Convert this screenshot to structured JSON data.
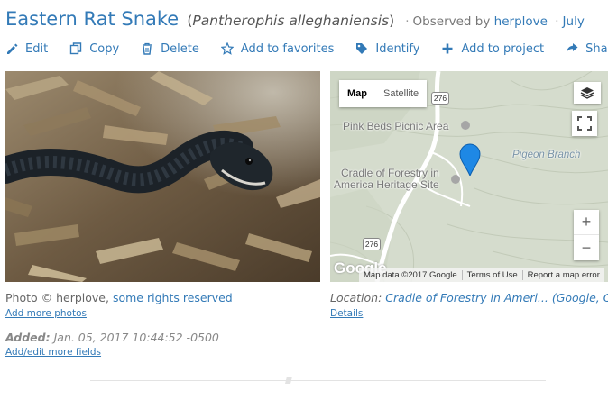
{
  "header": {
    "common_name": "Eastern Rat Snake",
    "scientific_name": "Pantherophis alleghaniensis",
    "observed_by_label": "Observed by",
    "observer": "herplove",
    "date": "July"
  },
  "actions": [
    {
      "label": "Edit",
      "icon": "pencil-icon"
    },
    {
      "label": "Copy",
      "icon": "copy-icon"
    },
    {
      "label": "Delete",
      "icon": "trash-icon"
    },
    {
      "label": "Add to favorites",
      "icon": "star-icon"
    },
    {
      "label": "Identify",
      "icon": "tag-icon"
    },
    {
      "label": "Add to project",
      "icon": "plus-icon"
    },
    {
      "label": "Share",
      "icon": "share-icon"
    }
  ],
  "map": {
    "type_map": "Map",
    "type_satellite": "Satellite",
    "zoom_in": "+",
    "zoom_out": "−",
    "labels": {
      "picnic": "Pink Beds Picnic Area",
      "cradle_line1": "Cradle of Forestry in",
      "cradle_line2": "America Heritage Site",
      "branch": "Pigeon Branch"
    },
    "route_top": "276",
    "route_bottom": "276",
    "logo": "Google",
    "footer": {
      "data": "Map data ©2017 Google",
      "terms": "Terms of Use",
      "report": "Report a map error"
    }
  },
  "photo": {
    "credit_prefix": "Photo © herplove,",
    "credit_link": "some rights reserved",
    "add_more": "Add more photos"
  },
  "location": {
    "label": "Location:",
    "value": "Cradle of Forestry in Ameri...",
    "sources": "(Google, OSM)",
    "details": "Details"
  },
  "added": {
    "label": "Added:",
    "value": "Jan. 05, 2017 10:44:52 -0500",
    "edit_fields": "Add/edit more fields"
  },
  "colors": {
    "link": "#337ab7",
    "pin": "#1e88e5"
  }
}
